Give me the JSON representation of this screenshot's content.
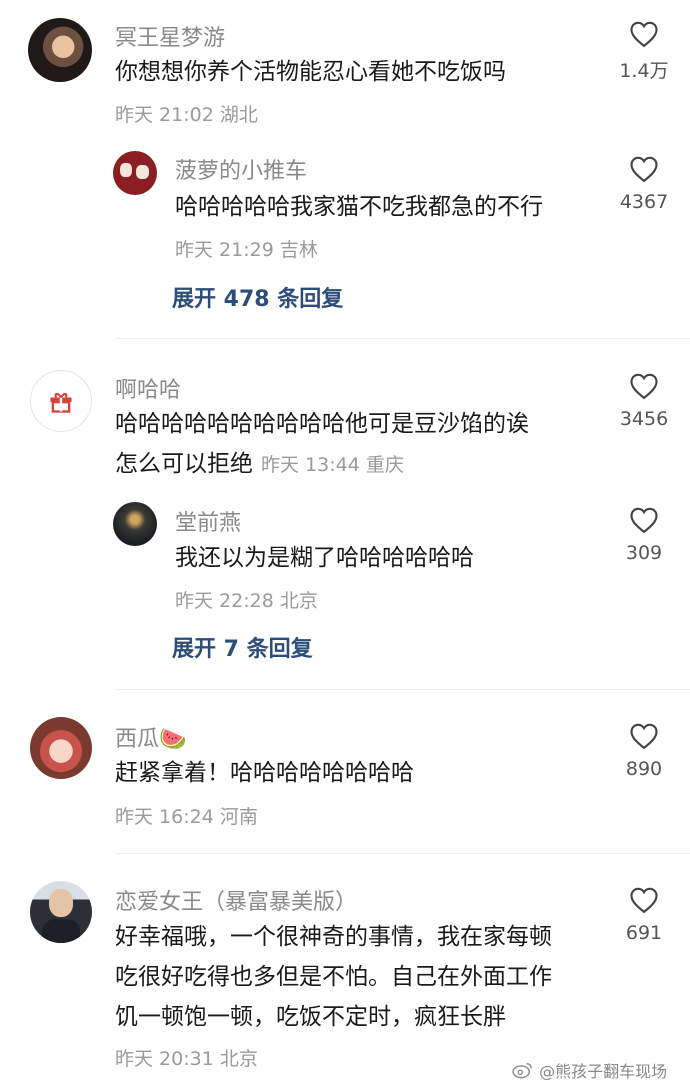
{
  "comments": [
    {
      "user": "冥王星梦游",
      "text": "你想想你养个活物能忍心看她不吃饭吗",
      "time": "昨天 21:02",
      "location": "湖北",
      "likes": "1.4万",
      "reply": {
        "user": "菠萝的小推车",
        "text": "哈哈哈哈哈我家猫不吃我都急的不行",
        "time": "昨天 21:29",
        "location": "吉林",
        "likes": "4367"
      },
      "expand": "展开 478 条回复"
    },
    {
      "user": "啊哈哈",
      "text_line1": "哈哈哈哈哈哈哈哈哈哈他可是豆沙馅的诶",
      "text_line2": "怎么可以拒绝",
      "time": "昨天 13:44",
      "location": "重庆",
      "likes": "3456",
      "reply": {
        "user": "堂前燕",
        "text": "我还以为是糊了哈哈哈哈哈哈",
        "time": "昨天 22:28",
        "location": "北京",
        "likes": "309"
      },
      "expand": "展开 7 条回复"
    },
    {
      "user": "西瓜",
      "user_emoji": "🍉",
      "text": "赶紧拿着！哈哈哈哈哈哈哈哈",
      "time": "昨天 16:24",
      "location": "河南",
      "likes": "890"
    },
    {
      "user": "恋爱女王（暴富暴美版）",
      "text_line1": "好幸福哦，一个很神奇的事情，我在家每顿",
      "text_line2": "吃很好吃得也多但是不怕。自己在外面工作",
      "text_line3": "饥一顿饱一顿，吃饭不定时，疯狂长胖",
      "time": "昨天 20:31",
      "location": "北京",
      "likes": "691"
    }
  ],
  "watermark": "@熊孩子翻车现场",
  "icons": {
    "like": "heart-outline-icon",
    "gift": "gift-icon",
    "weibo": "weibo-icon"
  },
  "colors": {
    "expand": "#2c4d7a",
    "meta": "#9a9a9a",
    "name": "#8a8a8a"
  }
}
